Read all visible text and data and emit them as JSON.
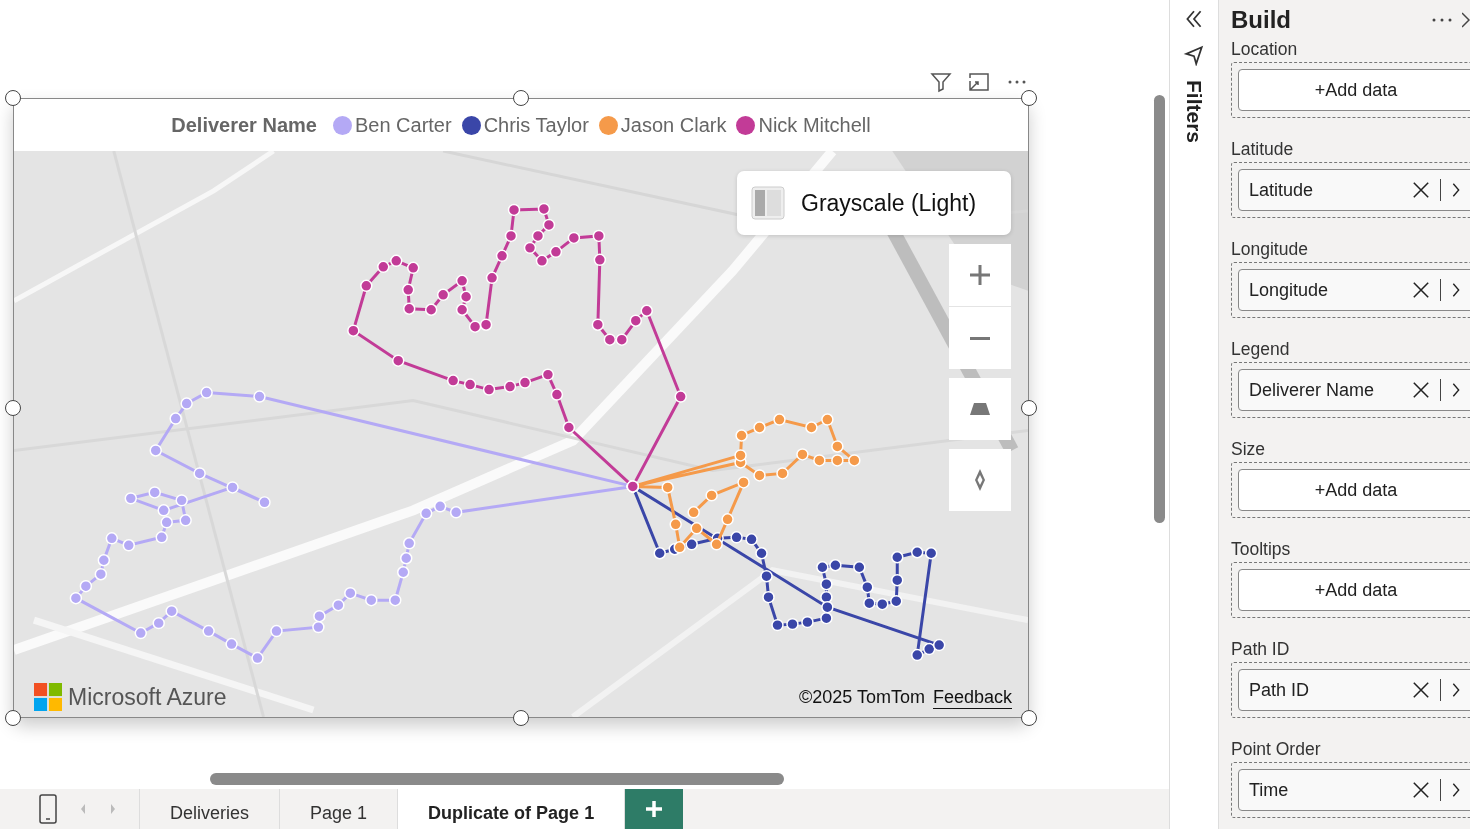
{
  "legend": {
    "title": "Deliverer Name",
    "items": [
      {
        "label": "Ben Carter",
        "color": "#b4a9f5"
      },
      {
        "label": "Chris Taylor",
        "color": "#3a46a8"
      },
      {
        "label": "Jason Clark",
        "color": "#f59a4a"
      },
      {
        "label": "Nick Mitchell",
        "color": "#c23b97"
      }
    ]
  },
  "map": {
    "style_label": "Grayscale (Light)",
    "brand": "Microsoft Azure",
    "copyright": "©2025 TomTom",
    "feedback": "Feedback"
  },
  "pane": {
    "filters_label": "Filters",
    "title": "Build",
    "wells": [
      {
        "label": "Location",
        "kind": "empty",
        "button": "+Add data"
      },
      {
        "label": "Latitude",
        "kind": "field",
        "value": "Latitude"
      },
      {
        "label": "Longitude",
        "kind": "field",
        "value": "Longitude"
      },
      {
        "label": "Legend",
        "kind": "field",
        "value": "Deliverer Name"
      },
      {
        "label": "Size",
        "kind": "empty",
        "button": "+Add data"
      },
      {
        "label": "Tooltips",
        "kind": "empty",
        "button": "+Add data"
      },
      {
        "label": "Path ID",
        "kind": "field",
        "value": "Path ID"
      },
      {
        "label": "Point Order",
        "kind": "field",
        "value": "Time"
      }
    ]
  },
  "page_tabs": [
    {
      "label": "Deliveries",
      "selected": false
    },
    {
      "label": "Page 1",
      "selected": false
    },
    {
      "label": "Duplicate of Page 1",
      "selected": true
    }
  ]
}
